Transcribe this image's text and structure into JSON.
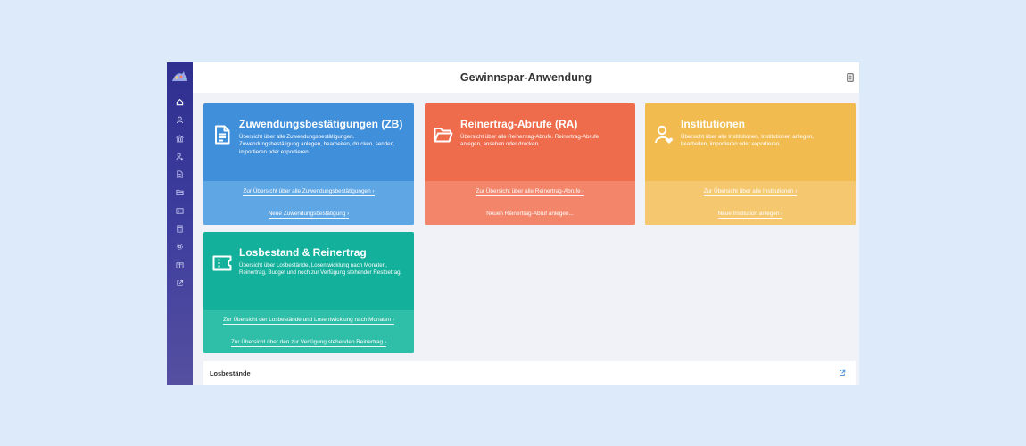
{
  "app": {
    "title": "Gewinnspar-Anwendung",
    "colors": {
      "sidebar": "#3d3d9e",
      "background": "#f1f2f8",
      "topbar": "#ffffff"
    }
  },
  "sidebar": {
    "items": [
      {
        "icon": "home-icon"
      },
      {
        "icon": "user-icon"
      },
      {
        "icon": "bank-icon"
      },
      {
        "icon": "user-heart-icon"
      },
      {
        "icon": "document-icon"
      },
      {
        "icon": "folder-icon"
      },
      {
        "icon": "ticket-icon"
      },
      {
        "icon": "calculator-icon"
      },
      {
        "icon": "gear-icon"
      },
      {
        "icon": "book-open-icon"
      },
      {
        "icon": "external-link-icon"
      }
    ]
  },
  "cards": {
    "zb": {
      "title": "Zuwendungsbestätigungen (ZB)",
      "description": "Übersicht über alle Zuwendungsbestätigungen. Zuwendungsbestätigung anlegen, bearbeiten, drucken, senden, importieren oder exportieren.",
      "link1": "Zur Übersicht über alle Zuwendungsbestätigungen ›",
      "link2": "Neue Zuwendungsbestätigung ›",
      "icon": "document-icon",
      "color": "#3f8fdb"
    },
    "ra": {
      "title": "Reinertrag-Abrufe (RA)",
      "description": "Übersicht über alle Reinertrag-Abrufe. Reinertrag-Abrufe anlegen, ansehen oder drucken.",
      "link1": "Zur Übersicht über alle Reinertrag-Abrufe ›",
      "link2": "Neuen Reinertrag-Abruf anlegen...",
      "icon": "folder-icon",
      "color": "#ee6b4c"
    },
    "inst": {
      "title": "Institutionen",
      "description": "Übersicht über alle Institutionen. Institutionen anlegen, bearbeiten, importieren oder exportieren.",
      "link1": "Zur Übersicht über alle Institutionen ›",
      "link2": "Neue Institution anlegen ›",
      "icon": "user-heart-icon",
      "color": "#f2bb50"
    },
    "los": {
      "title": "Losbestand & Reinertrag",
      "description": "Übersicht über Losbestände, Losentwicklung nach Monaten, Reinertrag, Budget und noch zur Verfügung stehender Restbetrag.",
      "link1": "Zur Übersicht der Losbestände und Losentwicklung nach Monaten ›",
      "link2": "Zur Übersicht über den zur Verfügung stehenden Reinertrag ›",
      "icon": "ticket-icon",
      "color": "#13b09b"
    }
  },
  "losbestaende": {
    "label": "Losbestände"
  }
}
